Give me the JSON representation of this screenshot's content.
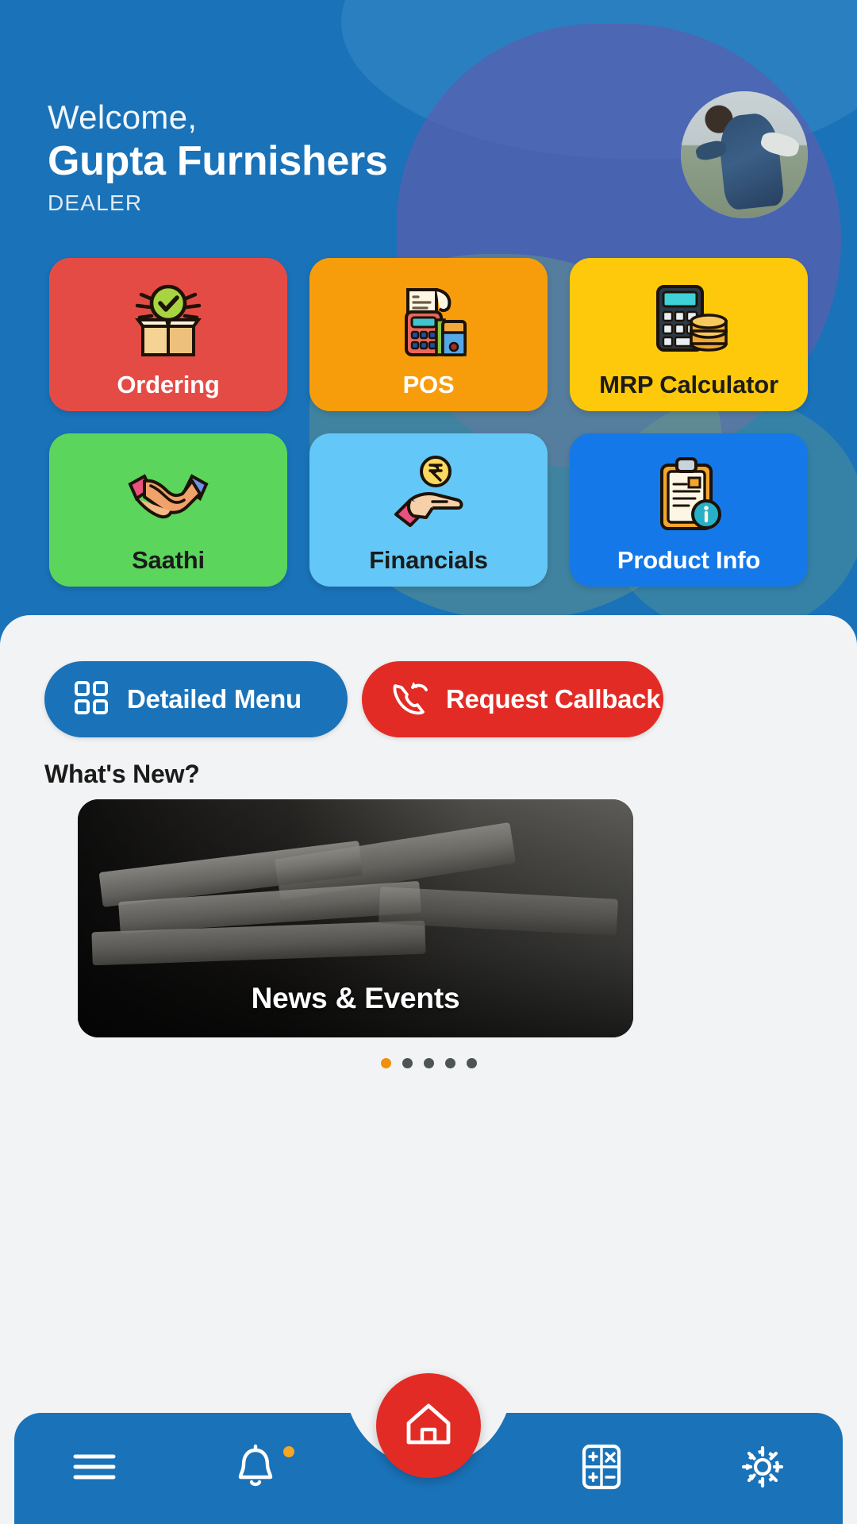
{
  "header": {
    "greeting": "Welcome,",
    "user_name": "Gupta Furnishers",
    "role": "DEALER",
    "avatar_name": "user-avatar",
    "bg_color": "#1a72b8"
  },
  "tiles": [
    {
      "label": "Ordering",
      "bg": "#e54b45",
      "text_color": "#ffffff",
      "icon": "package-check-icon"
    },
    {
      "label": "POS",
      "bg": "#f79d0c",
      "text_color": "#ffffff",
      "icon": "pos-terminal-icon"
    },
    {
      "label": "MRP Calculator",
      "bg": "#fdc90a",
      "text_color": "#1b1b1b",
      "icon": "calculator-coins-icon"
    },
    {
      "label": "Saathi",
      "bg": "#5bd55b",
      "text_color": "#1b1b1b",
      "icon": "handshake-icon"
    },
    {
      "label": "Financials",
      "bg": "#63c8f7",
      "text_color": "#1b1b1b",
      "icon": "rupee-hand-icon"
    },
    {
      "label": "Product Info",
      "bg": "#1478e8",
      "text_color": "#ffffff",
      "icon": "clipboard-info-icon"
    }
  ],
  "actions": {
    "detailed_menu": {
      "label": "Detailed Menu",
      "icon": "grid-icon",
      "color": "#1a72b8"
    },
    "request_callback": {
      "label": "Request Callback",
      "icon": "phone-callback-icon",
      "color": "#e32b25"
    }
  },
  "whats_new": {
    "title": "What's New?",
    "cards": [
      {
        "label": "News & Events",
        "image": "newspapers-photo"
      }
    ],
    "carousel": {
      "total_dots": 5,
      "active_index": 0,
      "active_color": "#f0900f",
      "inactive_color": "#4e5356"
    }
  },
  "bottom_nav": {
    "items": [
      {
        "name": "menu",
        "icon": "hamburger-menu-icon",
        "badge": false
      },
      {
        "name": "notifications",
        "icon": "bell-icon",
        "badge": true
      },
      {
        "name": "home",
        "icon": "home-icon",
        "badge": false,
        "is_fab": true,
        "color": "#e32b25"
      },
      {
        "name": "calculator",
        "icon": "calculator-icon",
        "badge": false
      },
      {
        "name": "settings",
        "icon": "gear-icon",
        "badge": false
      }
    ]
  }
}
